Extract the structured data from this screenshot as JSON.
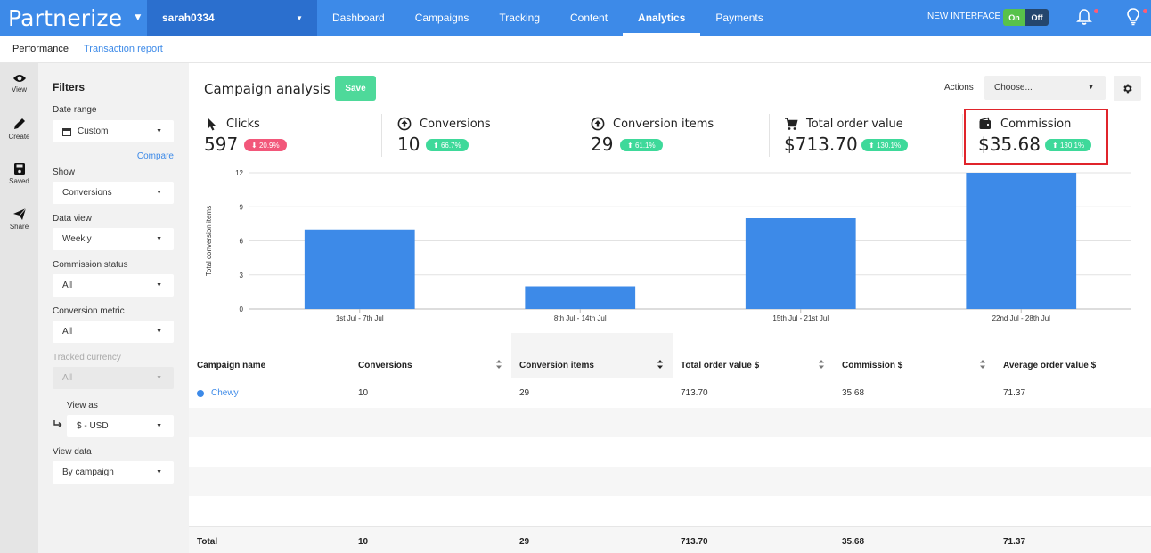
{
  "topbar": {
    "logo": "Partnerize",
    "account": "sarah0334",
    "nav": [
      "Dashboard",
      "Campaigns",
      "Tracking",
      "Content",
      "Analytics",
      "Payments"
    ],
    "active_nav": "Analytics",
    "new_interface_label": "NEW INTERFACE",
    "toggle_on": "On",
    "toggle_off": "Off",
    "icons": [
      "bell-icon",
      "lightbulb-icon"
    ],
    "accent": "#3d8ae8"
  },
  "subnav": {
    "performance": "Performance",
    "transaction_report": "Transaction report"
  },
  "rail": {
    "view": "View",
    "create": "Create",
    "saved": "Saved",
    "share": "Share"
  },
  "filters": {
    "title": "Filters",
    "date_range_label": "Date range",
    "date_range_value": "Custom",
    "compare": "Compare",
    "show_label": "Show",
    "show_value": "Conversions",
    "data_view_label": "Data view",
    "data_view_value": "Weekly",
    "commission_status_label": "Commission status",
    "commission_status_value": "All",
    "conversion_metric_label": "Conversion metric",
    "conversion_metric_value": "All",
    "tracked_currency_label": "Tracked currency",
    "tracked_currency_value": "All",
    "view_as_label": "View as",
    "view_as_value": "$ - USD",
    "view_data_label": "View data",
    "view_data_value": "By campaign"
  },
  "header": {
    "title": "Campaign analysis",
    "save": "Save",
    "actions_label": "Actions",
    "actions_placeholder": "Choose..."
  },
  "kpis": [
    {
      "label": "Clicks",
      "value": "597",
      "change": "20.9%",
      "direction": "down",
      "icon": "cursor-icon"
    },
    {
      "label": "Conversions",
      "value": "10",
      "change": "66.7%",
      "direction": "up",
      "icon": "arrow-up-circle-icon"
    },
    {
      "label": "Conversion items",
      "value": "29",
      "change": "61.1%",
      "direction": "up",
      "icon": "arrow-up-circle-icon"
    },
    {
      "label": "Total order value",
      "value": "$713.70",
      "change": "130.1%",
      "direction": "up",
      "icon": "cart-icon"
    },
    {
      "label": "Commission",
      "value": "$35.68",
      "change": "130.1%",
      "direction": "up",
      "icon": "wallet-icon"
    }
  ],
  "chart_data": {
    "type": "bar",
    "categories": [
      "1st Jul - 7th Jul",
      "8th Jul - 14th Jul",
      "15th Jul - 21st Jul",
      "22nd Jul - 28th Jul"
    ],
    "values": [
      7,
      2,
      8,
      12
    ],
    "ylabel": "Total conversion items",
    "xlabel": "",
    "ylim": [
      0,
      12
    ],
    "yticks": [
      0,
      3,
      6,
      9,
      12
    ],
    "grid": true,
    "bar_color": "#3d8ae8"
  },
  "table": {
    "columns": [
      "Campaign name",
      "Conversions",
      "Conversion items",
      "Total order value $",
      "Commission $",
      "Average order value $"
    ],
    "rows": [
      [
        "Chewy",
        "10",
        "29",
        "713.70",
        "35.68",
        "71.37"
      ]
    ],
    "total_label": "Total",
    "totals": [
      "10",
      "29",
      "713.70",
      "35.68",
      "71.37"
    ]
  }
}
